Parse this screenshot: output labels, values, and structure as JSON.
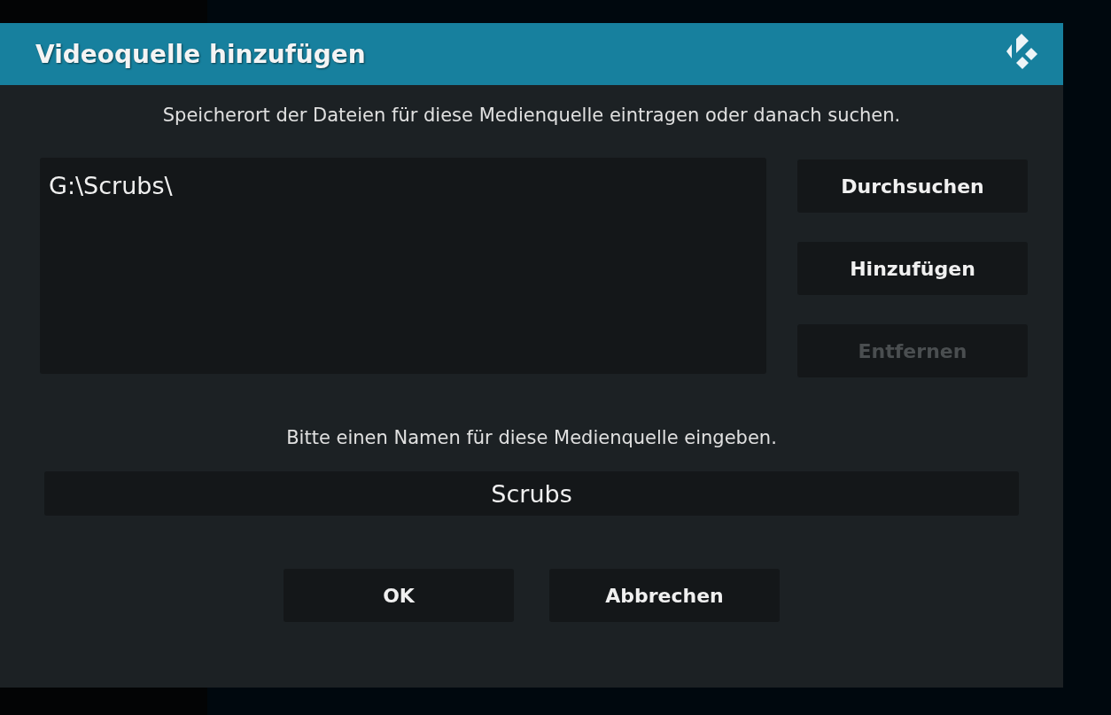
{
  "window": {
    "title": "Videoquelle hinzufügen"
  },
  "path_prompt": "Speicherort der Dateien für diese Medienquelle eintragen oder danach suchen.",
  "paths": [
    {
      "label": "G:\\Scrubs\\"
    }
  ],
  "side_buttons": [
    {
      "label": "Durchsuchen",
      "disabled": false
    },
    {
      "label": "Hinzufügen",
      "disabled": false
    },
    {
      "label": "Entfernen",
      "disabled": true
    }
  ],
  "name_prompt": "Bitte einen Namen für diese Medienquelle eingeben.",
  "name_field": {
    "value": "Scrubs"
  },
  "buttons": [
    {
      "label": "OK",
      "disabled": false
    },
    {
      "label": "Abbrechen",
      "disabled": false
    }
  ]
}
